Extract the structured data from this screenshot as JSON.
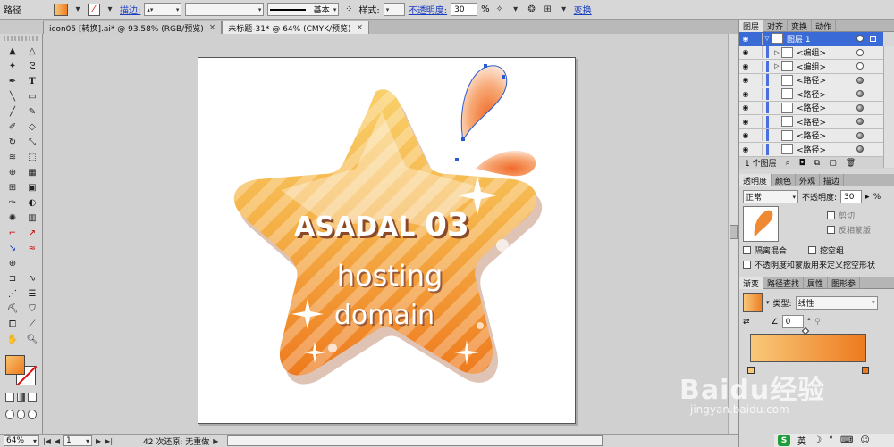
{
  "control_bar": {
    "object_type": "路径",
    "stroke_label": "描边:",
    "stroke_style": "基本",
    "style_label": "样式:",
    "opacity_label": "不透明度:",
    "opacity_value": "30",
    "opacity_unit": "%",
    "transform_label": "变换"
  },
  "tabs": [
    {
      "label": "icon05 [转换].ai* @ 93.58% (RGB/预览)",
      "close": "×"
    },
    {
      "label": "未标题-31* @ 64% (CMYK/预览)",
      "close": "×"
    }
  ],
  "artwork": {
    "title_text": "ASADAL",
    "title_number": "03",
    "line1": "hosting",
    "line2": "domain",
    "colors": {
      "star_top": "#f9d36b",
      "star_bottom": "#ef7c1e",
      "text": "#ffffff",
      "shadow": "#8a4a2a"
    }
  },
  "status_bar": {
    "zoom": "64%",
    "page": "1",
    "message": "42 次还原; 无重做"
  },
  "layers_panel": {
    "tabs": [
      "图层",
      "对齐",
      "变换",
      "动作"
    ],
    "rows": [
      {
        "name": "图层 1",
        "level": 0,
        "selected": true
      },
      {
        "name": "<编组>",
        "level": 1,
        "expand": "▷"
      },
      {
        "name": "<编组>",
        "level": 1,
        "expand": "▷"
      },
      {
        "name": "<路径>",
        "level": 1
      },
      {
        "name": "<路径>",
        "level": 1
      },
      {
        "name": "<路径>",
        "level": 1
      },
      {
        "name": "<路径>",
        "level": 1
      },
      {
        "name": "<路径>",
        "level": 1
      },
      {
        "name": "<路径>",
        "level": 1
      }
    ],
    "footer_count": "1 个图层"
  },
  "transparency_panel": {
    "tabs": [
      "透明度",
      "颜色",
      "外观",
      "描边"
    ],
    "blend_mode": "正常",
    "opacity_label": "不透明度:",
    "opacity_value": "30",
    "opacity_unit": "%",
    "clip_label": "剪切",
    "invert_label": "反相蒙版",
    "isolate_label": "隔离混合",
    "knockout_label": "挖空组",
    "define_label": "不透明度和蒙版用来定义挖空形状"
  },
  "gradient_panel": {
    "tabs": [
      "渐变",
      "路径查找",
      "属性",
      "图形参"
    ],
    "type_label": "类型:",
    "type_value": "线性",
    "angle_value": "0",
    "angle_unit": "°",
    "start_color": "#f8c97a",
    "end_color": "#ee7a1e"
  },
  "watermark": {
    "brand": "Baidu经验",
    "url": "jingyan.baidu.com"
  },
  "ime": {
    "logo": "S",
    "lang": "英"
  }
}
